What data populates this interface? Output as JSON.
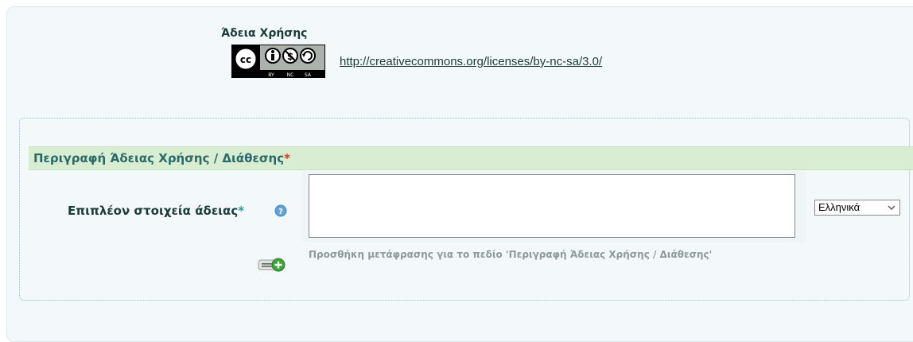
{
  "license": {
    "title": "Άδεια Χρήσης",
    "badge": {
      "icon": "cc-by-nc-sa-badge",
      "labels": [
        "BY",
        "NC",
        "SA"
      ]
    },
    "link_text": "http://creativecommons.org/licenses/by-nc-sa/3.0/"
  },
  "section": {
    "title": "Περιγραφή Άδειας Χρήσης / Διάθεσης",
    "required_marker": "*",
    "field": {
      "label": "Επιπλέον στοιχεία άδειας",
      "required_marker": "*",
      "help_icon": "help-icon",
      "value": ""
    },
    "language": {
      "selected": "Ελληνικά"
    },
    "add_translation": {
      "icon": "add-translation-icon",
      "text": "Προσθήκη μετάφρασης για το πεδίο 'Περιγραφή Άδειας Χρήσης / Διάθεσης'"
    }
  },
  "colors": {
    "panel_background": "#f3f9fa",
    "section_header_background": "#d9edd2",
    "section_header_text": "#2b6a6a",
    "required": "#d93a2b",
    "help": "#4a90c8",
    "add_green": "#3aa53a"
  }
}
